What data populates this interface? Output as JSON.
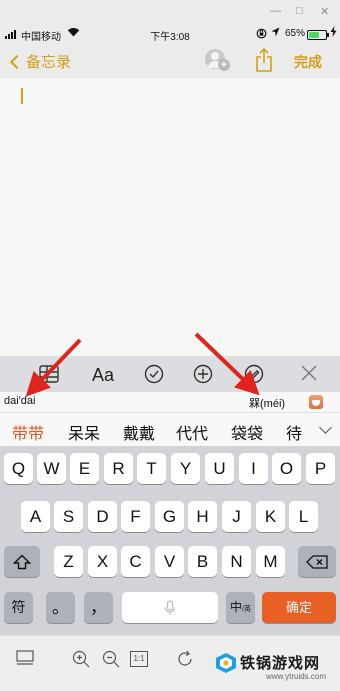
{
  "window": {
    "minimize": "—",
    "maximize": "□",
    "close": "✕"
  },
  "status_bar": {
    "carrier": "中国移动",
    "time": "下午3:08",
    "battery_pct": "65%",
    "battery_level": 0.65,
    "icons": [
      "signal-icon",
      "wifi-icon",
      "rotation-lock-icon",
      "location-icon",
      "battery-icon",
      "charging-icon"
    ]
  },
  "nav": {
    "back_label": "备忘录",
    "done_label": "完成",
    "accent": "#d4a017",
    "icons": [
      "chevron-left-icon",
      "add-people-icon",
      "share-icon"
    ]
  },
  "format_bar": {
    "text_style_label": "Aa",
    "icons": [
      "table-icon",
      "checklist-icon",
      "add-icon",
      "sketch-icon",
      "close-icon"
    ]
  },
  "pinyin": {
    "composition": "dai'dai",
    "hint": "槑(méi)"
  },
  "candidates": [
    "带带",
    "呆呆",
    "戴戴",
    "代代",
    "袋袋",
    "待"
  ],
  "keyboard": {
    "row1": [
      "Q",
      "W",
      "E",
      "R",
      "T",
      "Y",
      "U",
      "I",
      "O",
      "P"
    ],
    "row2": [
      "A",
      "S",
      "D",
      "F",
      "G",
      "H",
      "J",
      "K",
      "L"
    ],
    "row3": [
      "Z",
      "X",
      "C",
      "V",
      "B",
      "N",
      "M"
    ],
    "symbol_key": "符",
    "period_key": "。",
    "comma_key": "，",
    "lang_key": "中",
    "lang_key_sub": "/英",
    "confirm_key": "确定",
    "confirm_color": "#e96024"
  },
  "watermark": {
    "name": "铁锅游戏网",
    "url": "www.ytruids.com"
  },
  "toolbar": {
    "fit_label": "1:1"
  },
  "annotation_color": "#e0241b"
}
